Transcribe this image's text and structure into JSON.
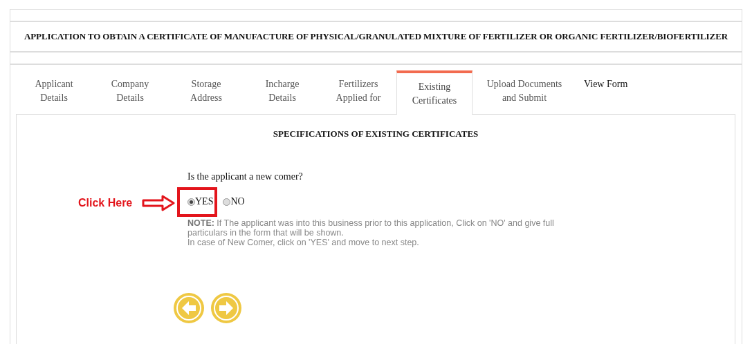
{
  "title": "APPLICATION TO OBTAIN A CERTIFICATE OF MANUFACTURE OF PHYSICAL/GRANULATED MIXTURE OF FERTILIZER OR ORGANIC FERTILIZER/BIOFERTILIZER",
  "tabs": [
    {
      "label": "Applicant Details",
      "selected": false
    },
    {
      "label": "Company Details",
      "selected": false
    },
    {
      "label": "Storage Address",
      "selected": false
    },
    {
      "label": "Incharge Details",
      "selected": false
    },
    {
      "label": "Fertilizers Applied for",
      "selected": false
    },
    {
      "label": "Existing Certificates",
      "selected": true
    },
    {
      "label": "Upload Documents and Submit",
      "selected": false
    },
    {
      "label": "View Form",
      "selected": false
    }
  ],
  "section_title": "SPECIFICATIONS OF EXISTING CERTIFICATES",
  "question": "Is the applicant a new comer?",
  "options": [
    {
      "label": "YES",
      "selected": true
    },
    {
      "label": "NO",
      "selected": false
    }
  ],
  "note": "**NOTE:** If The applicant was into this business prior to this application, Click on 'NO' and give full particulars in the form that will be shown.",
  "note_2": "In case of New Comer, click on 'YES' and move to next step.",
  "annotation": {
    "label": "Click Here"
  }
}
